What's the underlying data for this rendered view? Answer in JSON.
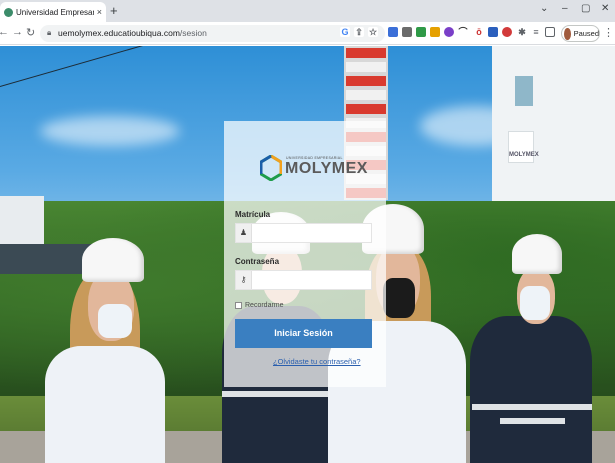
{
  "browser": {
    "tab_title": "Universidad Empresarial Molymex",
    "tab_close": "×",
    "new_tab": "+",
    "url_host": "uemolymex.educatioubiqua.com",
    "url_path": "/sesion",
    "profile_label": "Paused",
    "win_minimize": "⌄",
    "win_dash": "–",
    "win_restore": "▢",
    "win_close": "✕"
  },
  "scene": {
    "building_sign": "MOLYMEX"
  },
  "login": {
    "logo_small": "UNIVERSIDAD EMPRESARIAL",
    "logo_text": "MOLYMEX",
    "username_label": "Matrícula",
    "username_value": "",
    "password_label": "Contraseña",
    "password_value": "",
    "remember_label": "Recordarme",
    "submit_label": "Iniciar Sesión",
    "forgot_link": "¿Olvidaste tu contraseña?"
  },
  "colors": {
    "primary_button": "#3a7fc1",
    "link": "#2a5fae"
  },
  "icons": {
    "username": "user-icon",
    "password": "key-icon"
  }
}
